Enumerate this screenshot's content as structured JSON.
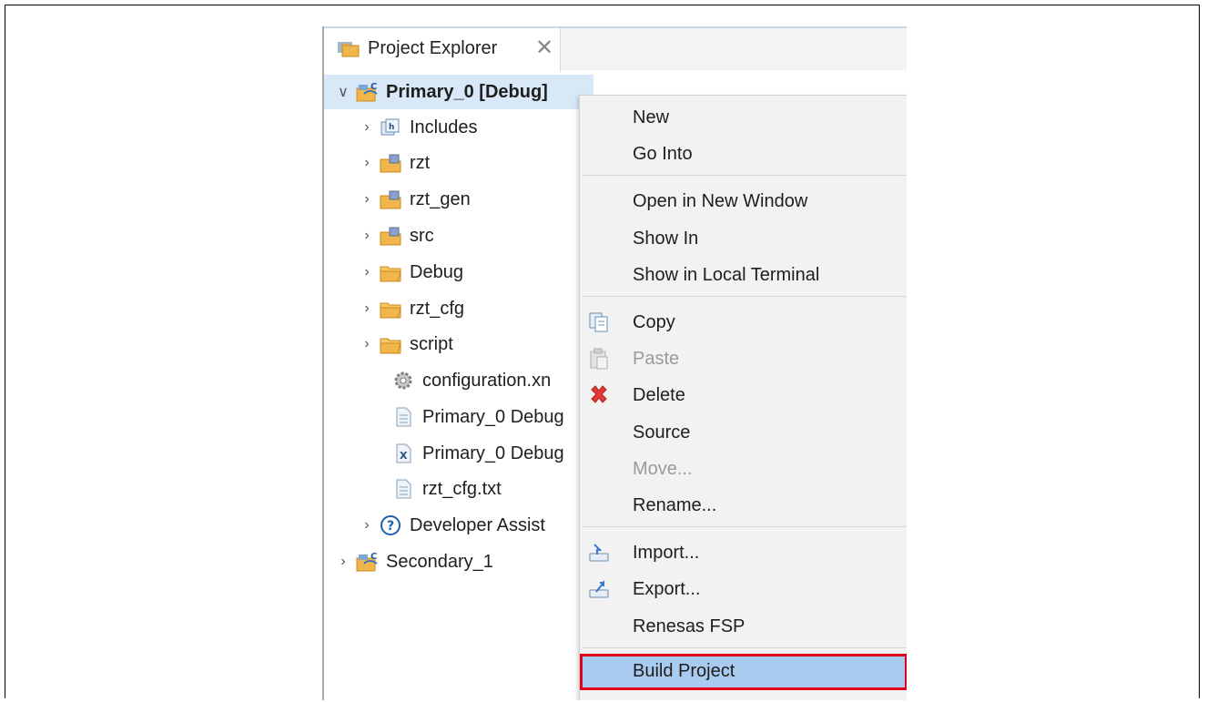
{
  "window": {
    "tab_title": "Project Explorer"
  },
  "tree": {
    "root_primary": "Primary_0 [Debug]",
    "items": [
      "Includes",
      "rzt",
      "rzt_gen",
      "src",
      "Debug",
      "rzt_cfg",
      "script",
      "configuration.xn",
      "Primary_0 Debug",
      "Primary_0 Debug",
      "rzt_cfg.txt",
      "Developer Assist"
    ],
    "root_secondary": "Secondary_1"
  },
  "context_menu": {
    "new": "New",
    "go_into": "Go Into",
    "open_in_new_window": "Open in New Window",
    "show_in": "Show In",
    "show_in_local_terminal": "Show in Local Terminal",
    "copy": "Copy",
    "paste": "Paste",
    "delete": "Delete",
    "source": "Source",
    "move": "Move...",
    "rename": "Rename...",
    "import": "Import...",
    "export": "Export...",
    "renesas_fsp": "Renesas FSP",
    "build_project": "Build Project"
  },
  "colors": {
    "selection_bg": "#d9e8f8",
    "menu_bg": "#f2f2f2",
    "menu_highlight": "#a9cbef",
    "highlight_border": "#e0001a",
    "folder": "#f0b54b",
    "delete_red": "#e53935"
  }
}
